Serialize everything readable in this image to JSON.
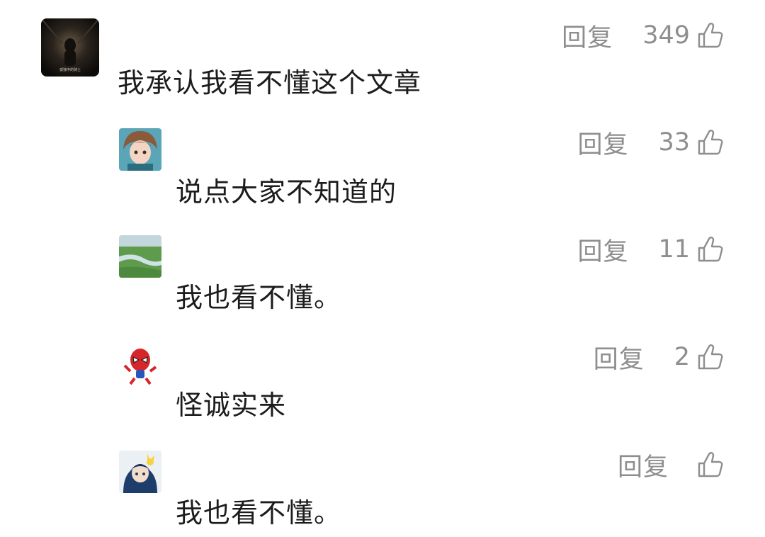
{
  "comments": [
    {
      "text": "我承认我看不懂这个文章",
      "reply_label": "回复",
      "likes": "349",
      "avatar_icon": "dark-tunnel-figure-avatar",
      "avatar_caption": "孤独中的骑士"
    },
    {
      "text": "说点大家不知道的",
      "reply_label": "回复",
      "likes": "33",
      "avatar_icon": "anime-boy-avatar"
    },
    {
      "text": "我也看不懂。",
      "reply_label": "回复",
      "likes": "11",
      "avatar_icon": "landscape-river-avatar"
    },
    {
      "text": "怪诚实来",
      "reply_label": "回复",
      "likes": "2",
      "avatar_icon": "spiderman-avatar"
    },
    {
      "text": "我也看不懂。",
      "reply_label": "回复",
      "likes": "",
      "avatar_icon": "anime-girl-pikachu-avatar"
    }
  ],
  "colors": {
    "text": "#1c1c1c",
    "meta": "#8e8e8e",
    "background": "#ffffff"
  }
}
